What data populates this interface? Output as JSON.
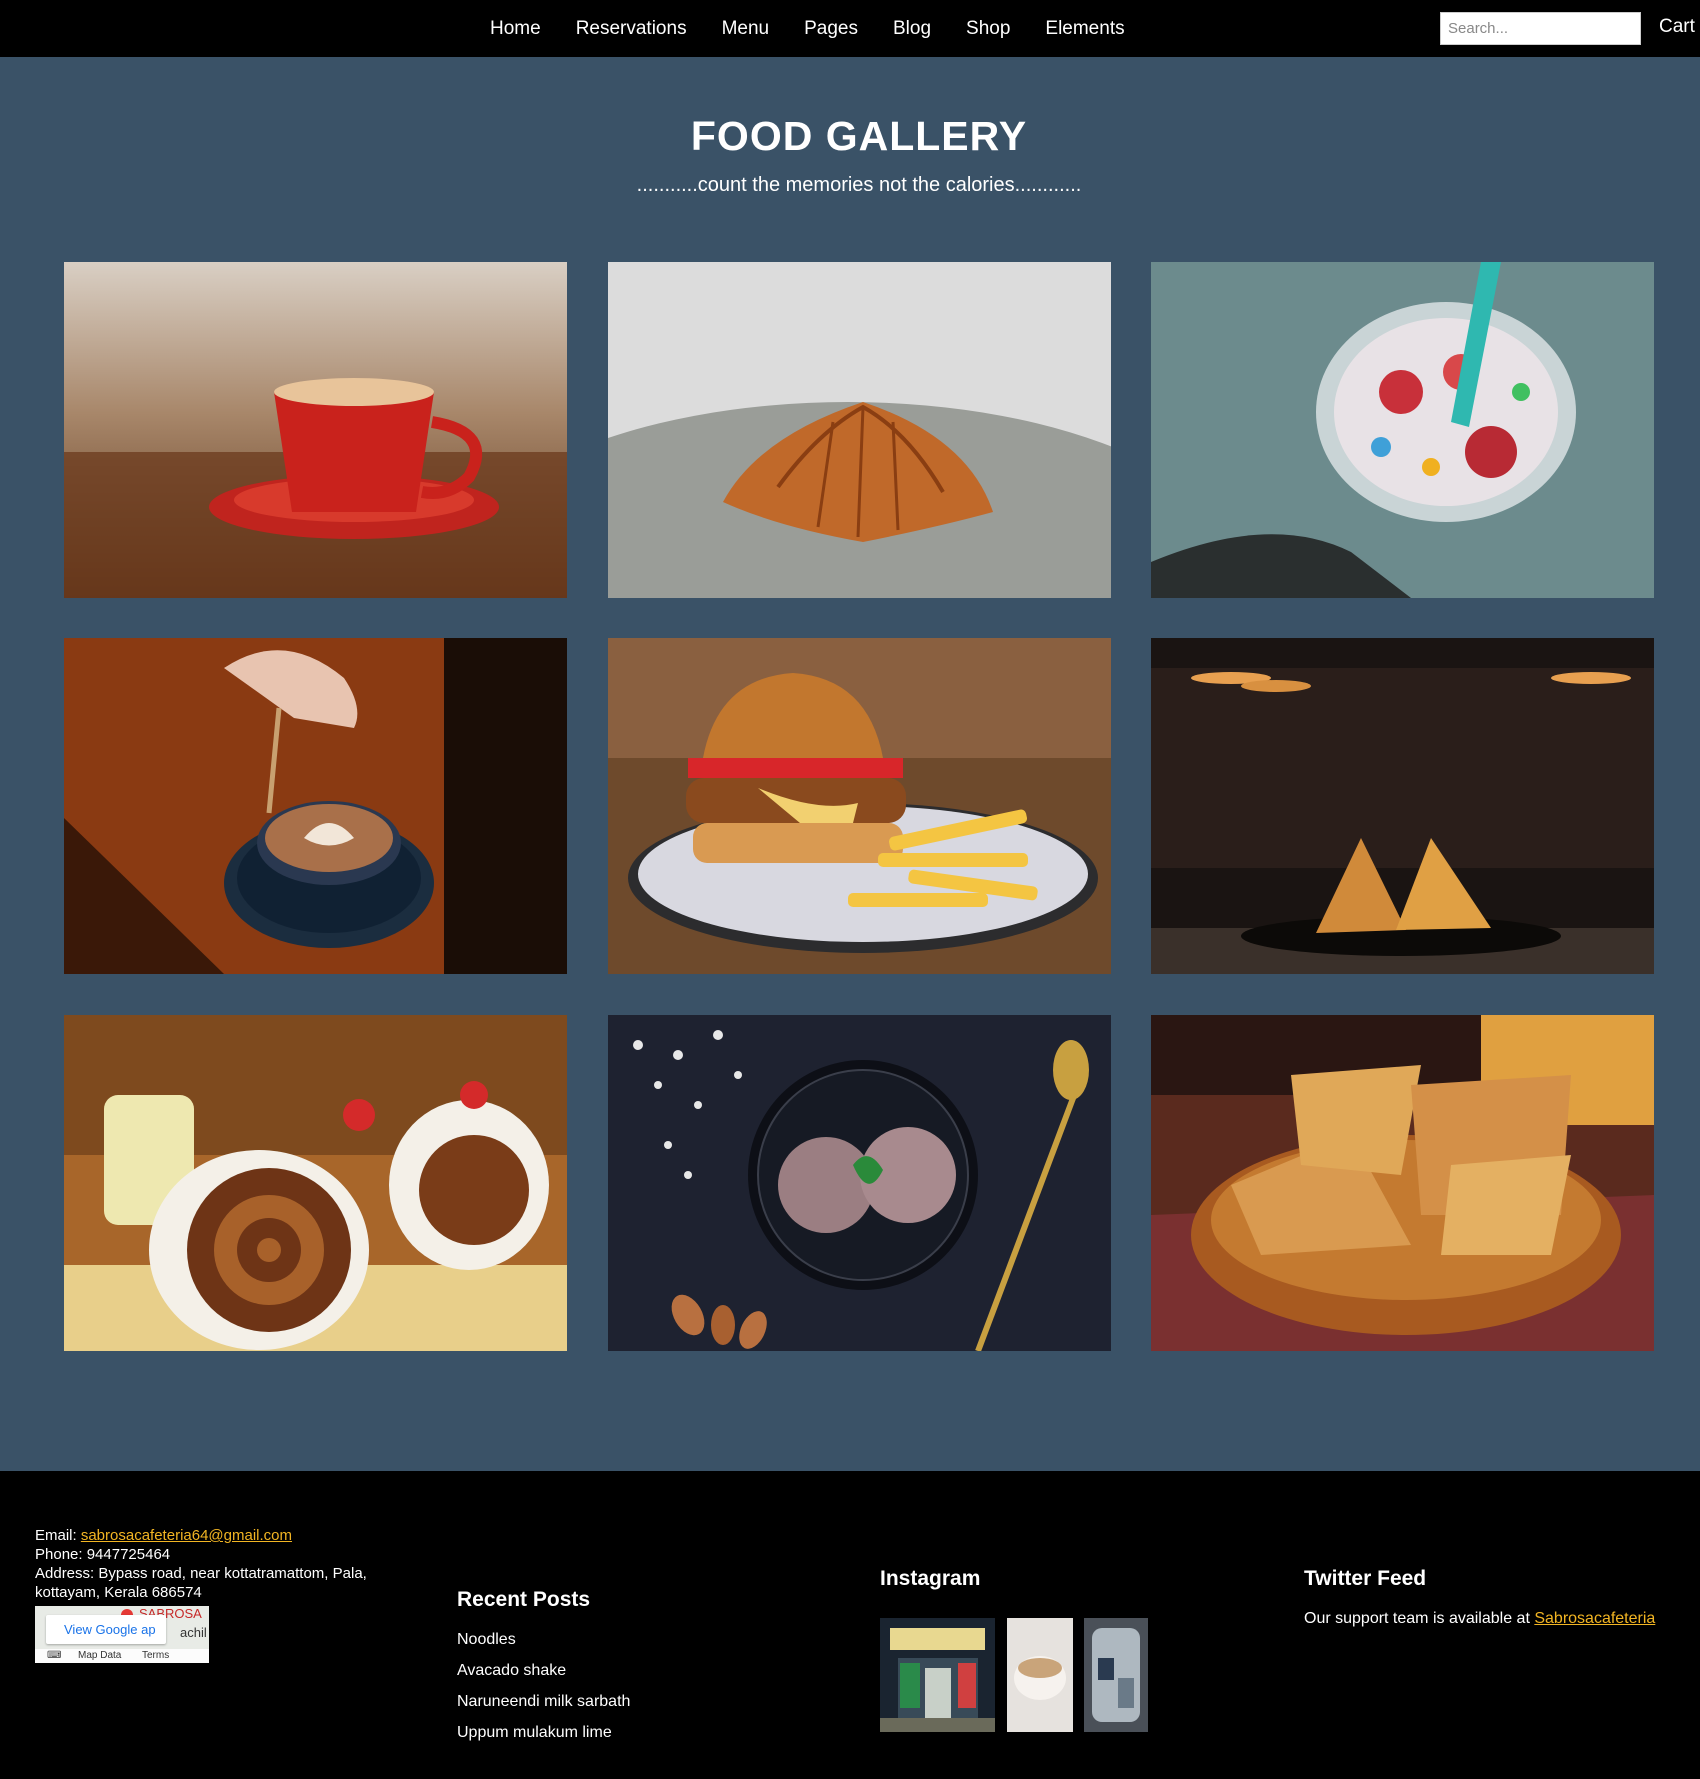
{
  "nav": {
    "items": [
      {
        "label": "Home"
      },
      {
        "label": "Reservations"
      },
      {
        "label": "Menu"
      },
      {
        "label": "Pages"
      },
      {
        "label": "Blog"
      },
      {
        "label": "Shop"
      },
      {
        "label": "Elements"
      }
    ],
    "search_placeholder": "Search...",
    "cart_label": "Cart"
  },
  "header": {
    "title": "FOOD GALLERY",
    "subtitle": "...........count the memories not the calories............"
  },
  "gallery": {
    "photos": [
      {
        "subject": "red coffee cup on saucer"
      },
      {
        "subject": "croissant"
      },
      {
        "subject": "fruit cereal shake with straw"
      },
      {
        "subject": "latte art coffee with spoon"
      },
      {
        "subject": "burger with fries"
      },
      {
        "subject": "samosas"
      },
      {
        "subject": "chocolate swiss roll cake"
      },
      {
        "subject": "chocolate ice cream with mint"
      },
      {
        "subject": "parathas in basket"
      }
    ]
  },
  "footer": {
    "contact": {
      "email_label": "Email: ",
      "email": "sabrosacafeteria64@gmail.com",
      "phone": "Phone: 9447725464",
      "address": "Address: Bypass road, near kottatramattom, Pala, kottayam, Kerala 686574"
    },
    "map": {
      "button": "View Google ap",
      "place_text": "SABROSA",
      "side_text": "achil",
      "map_data": "Map Data",
      "terms": "Terms"
    },
    "recent_posts": {
      "heading": "Recent Posts",
      "items": [
        "Noodles",
        "Avacado shake",
        "Naruneendi milk sarbath",
        "Uppum mulakum lime"
      ]
    },
    "instagram": {
      "heading": "Instagram"
    },
    "twitter": {
      "heading": "Twitter Feed",
      "text": "Our support team is available at ",
      "link": "Sabrosacafeteria"
    }
  }
}
